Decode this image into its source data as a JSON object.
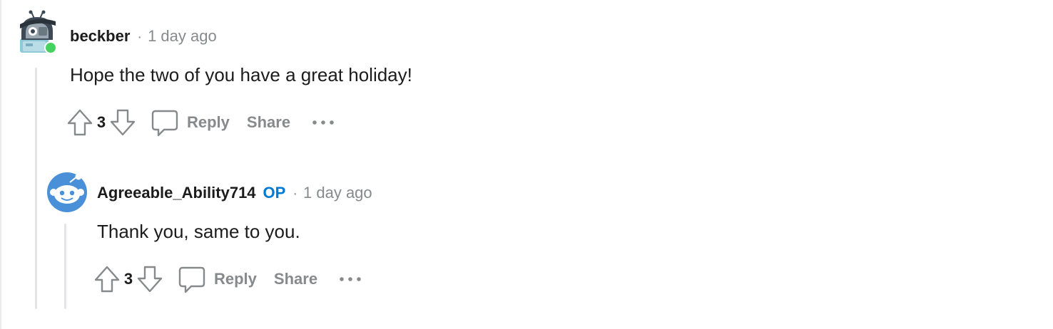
{
  "comments": [
    {
      "author": "beckber",
      "is_op": false,
      "time": "1 day ago",
      "body": "Hope the two of you have a great holiday!",
      "score": "3",
      "reply_label": "Reply",
      "share_label": "Share",
      "avatar_icon": "robot-snoo-avatar-icon",
      "online": true
    },
    {
      "author": "Agreeable_Ability714",
      "is_op": true,
      "op_label": "OP",
      "time": "1 day ago",
      "body": "Thank you, same to you.",
      "score": "3",
      "reply_label": "Reply",
      "share_label": "Share",
      "avatar_icon": "default-snoo-avatar-icon"
    }
  ],
  "separator": "·",
  "colors": {
    "accent_op": "#0079d3",
    "meta_gray": "#878a8c",
    "online_green": "#46d160",
    "avatar_blue": "#4a90d9",
    "thread_line": "#e4e4e7"
  }
}
